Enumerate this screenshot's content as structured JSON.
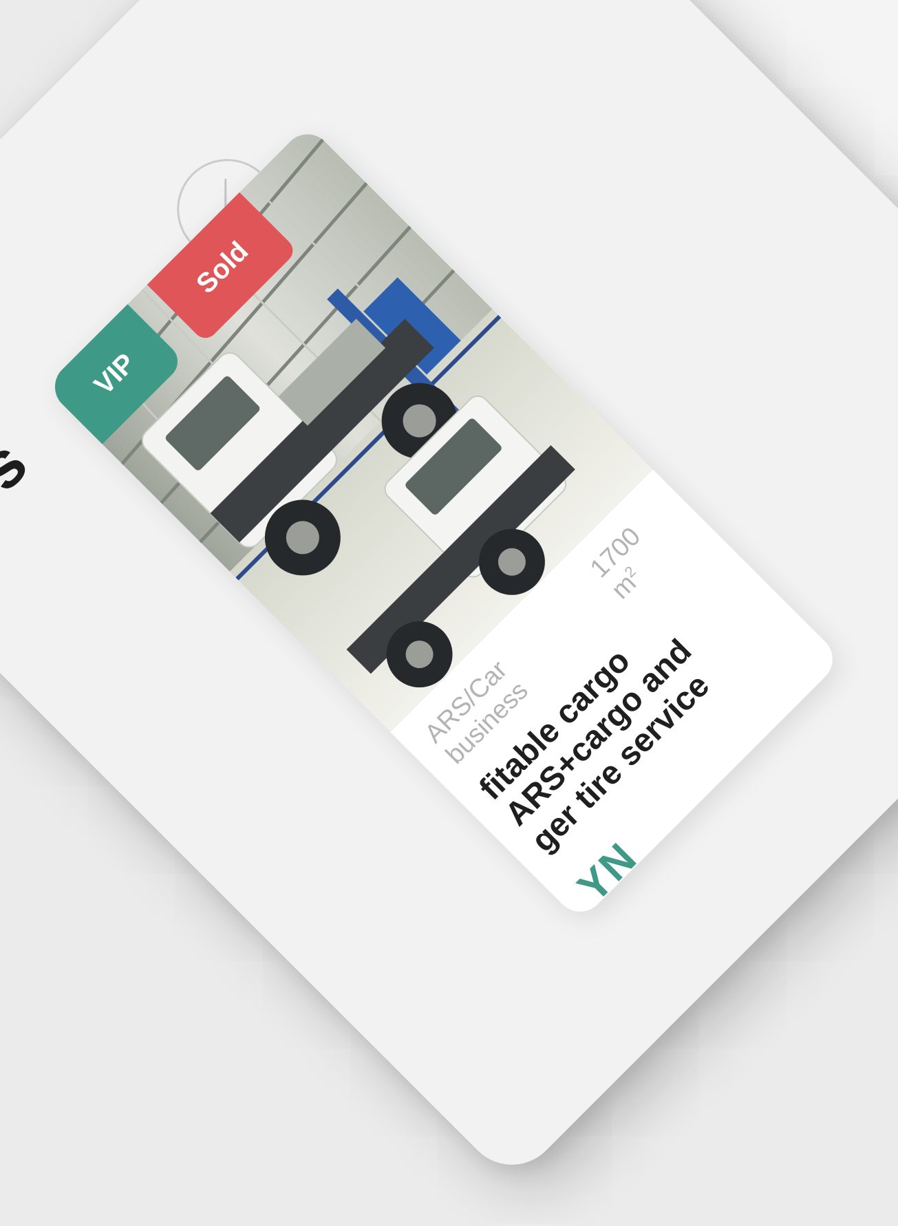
{
  "header": {
    "title": "ers"
  },
  "card": {
    "badges": {
      "vip": "VIP",
      "sold": "Sold"
    },
    "category": "ARS/Car business",
    "area_value": "1700 m",
    "area_unit_sup": "2",
    "title_lines": [
      "fitable cargo ARS+cargo and",
      "ger tire service"
    ],
    "price_fragment": "YN"
  },
  "colors": {
    "accent": "#3e9a86",
    "sold": "#e05558",
    "text": "#1d1d1d",
    "muted": "#b3b3b3"
  },
  "icons": {
    "clock": "clock-icon"
  }
}
